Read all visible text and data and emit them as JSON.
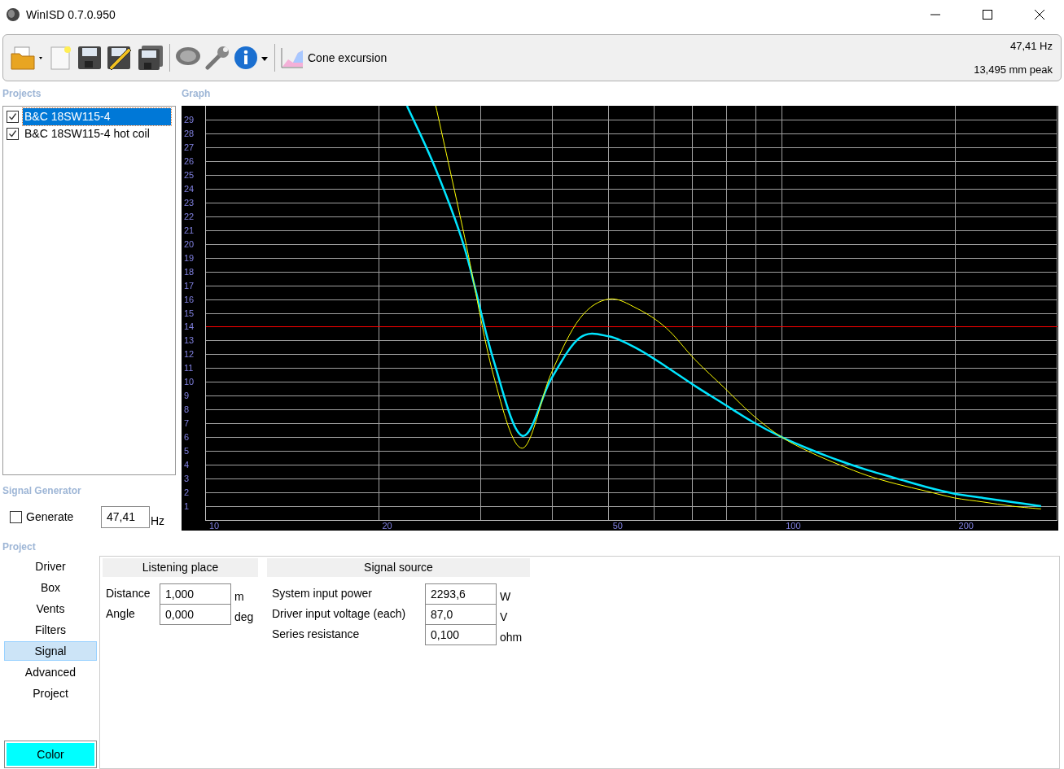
{
  "window": {
    "title": "WinISD 0.7.0.950"
  },
  "toolbar": {
    "graph_selector": "Cone excursion",
    "readout_frequency": "47,41 Hz",
    "readout_value": "13,495 mm peak"
  },
  "projects": {
    "label": "Projects",
    "items": [
      {
        "label": "B&C 18SW115-4",
        "checked": true,
        "selected": true
      },
      {
        "label": "B&C 18SW115-4 hot coil",
        "checked": true,
        "selected": false
      }
    ]
  },
  "graph": {
    "label": "Graph",
    "chart_data": {
      "type": "line",
      "categories": [
        "10",
        null,
        null,
        null,
        null,
        null,
        "20",
        null,
        null,
        null,
        null,
        null,
        null,
        null,
        "50",
        null,
        null,
        null,
        null,
        null,
        "100",
        null,
        null,
        null,
        null,
        null,
        "200",
        null,
        null,
        null
      ],
      "series": [
        {
          "color": "#00e5ff",
          "values": [
            null,
            null,
            null,
            null,
            null,
            null,
            null,
            30,
            25.4,
            19.7,
            11.6,
            6.1,
            10.2,
            13.2,
            13.3,
            12.4,
            11.1,
            9.7,
            8.4,
            7.1,
            6,
            5.1,
            4.3,
            3.6,
            3,
            2.4,
            1.9,
            1.6,
            1.3,
            1
          ]
        },
        {
          "color": "#ffff00",
          "values": [
            null,
            null,
            null,
            null,
            null,
            null,
            null,
            null,
            30,
            20.5,
            10.5,
            5.2,
            10.6,
            14.6,
            16,
            15.3,
            13.9,
            11.6,
            9.6,
            7.6,
            6,
            4.9,
            4,
            3.2,
            2.6,
            2.1,
            1.6,
            1.3,
            1,
            0.8
          ]
        }
      ],
      "ylim": [
        0,
        30
      ],
      "grid": true,
      "yticks": [
        1,
        2,
        3,
        4,
        5,
        6,
        7,
        8,
        9,
        10,
        11,
        12,
        13,
        14,
        15,
        16,
        17,
        18,
        19,
        20,
        21,
        22,
        23,
        24,
        25,
        26,
        27,
        28,
        29
      ],
      "ref_lines": [
        {
          "axis": "y",
          "value": 14
        }
      ]
    }
  },
  "signal_generator": {
    "label": "Signal Generator",
    "generate": {
      "label": "Generate",
      "checked": false
    },
    "frequency": {
      "value": "47,41",
      "unit": "Hz"
    }
  },
  "project": {
    "label": "Project",
    "nav": [
      {
        "label": "Driver",
        "selected": false
      },
      {
        "label": "Box",
        "selected": false
      },
      {
        "label": "Vents",
        "selected": false
      },
      {
        "label": "Filters",
        "selected": false
      },
      {
        "label": "Signal",
        "selected": true
      },
      {
        "label": "Advanced",
        "selected": false
      },
      {
        "label": "Project",
        "selected": false
      }
    ],
    "color_button": {
      "label": "Color",
      "color": "#00ffff"
    },
    "groups": [
      {
        "title": "Listening place",
        "fields": [
          {
            "label": "Distance",
            "value": "1,000",
            "unit": "m"
          },
          {
            "label": "Angle",
            "value": "0,000",
            "unit": "deg"
          }
        ]
      },
      {
        "title": "Signal source",
        "fields": [
          {
            "label": "System input power",
            "value": "2293,6",
            "unit": "W"
          },
          {
            "label": "Driver input voltage (each)",
            "value": "87,0",
            "unit": "V"
          },
          {
            "label": "Series resistance",
            "value": "0,100",
            "unit": "ohm"
          }
        ]
      }
    ]
  }
}
